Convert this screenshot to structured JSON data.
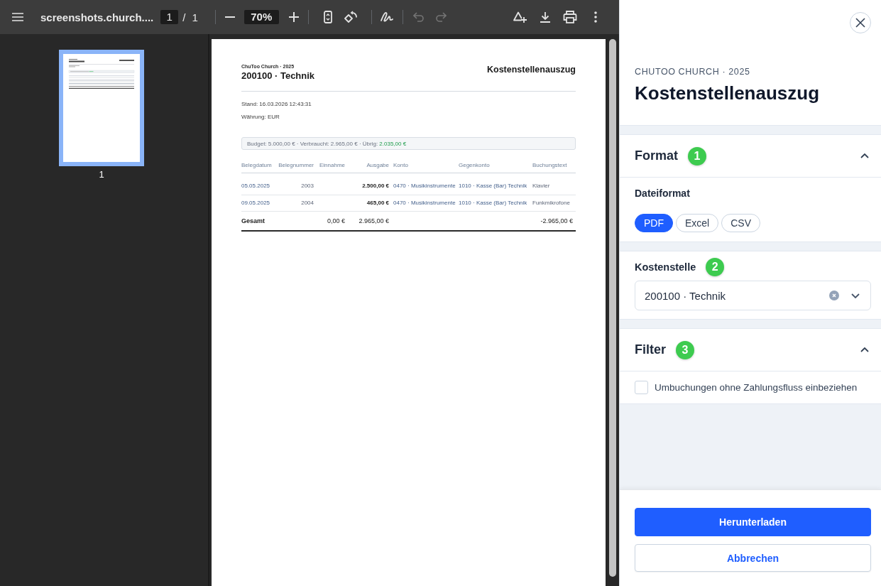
{
  "viewer": {
    "toolbar": {
      "title": "screenshots.church....",
      "page_number": "1",
      "page_separator": "/",
      "page_count": "1",
      "zoom": "70%",
      "undo_disabled": true,
      "redo_disabled": true
    },
    "thumbnails": [
      {
        "label": "1",
        "selected": true
      }
    ],
    "document": {
      "organization": "ChuToo Church · 2025",
      "cost_center": "200100 · Technik",
      "title": "Kostenstellenauszug",
      "meta": [
        "Stand: 16.03.2026 12:43:31",
        "Währung: EUR"
      ],
      "budget": {
        "text": "Budget: 5.000,00 € · Verbraucht: 2.965,00 € · Übrig:",
        "remaining": "2.035,00 €"
      },
      "table": {
        "columns": [
          "Belegdatum",
          "Belegnummer",
          "Einnahme",
          "Ausgabe",
          "Konto",
          "Gegenkonto",
          "Buchungstext"
        ],
        "rows": [
          {
            "date": "05.05.2025",
            "number": "2003",
            "expense": "2.500,00 €",
            "account": "0470 · Musikinstrumente",
            "contra_account": "1010 · Kasse (Bar) Technik",
            "text": "Klavier"
          },
          {
            "date": "09.05.2025",
            "number": "2004",
            "expense": "465,00 €",
            "account": "0470 · Musikinstrumente",
            "contra_account": "1010 · Kasse (Bar) Technik",
            "text": "Funkmikrofone"
          }
        ],
        "total": {
          "label": "Gesamt",
          "income": "0,00 €",
          "expense": "2.965,00 €",
          "balance": "-2.965,00 €"
        }
      }
    }
  },
  "panel": {
    "eyebrow": "CHUTOO CHURCH · 2025",
    "title": "Kostenstellenauszug",
    "sections": [
      {
        "kind": "choice",
        "title": "Format",
        "badge": "1",
        "expanded": true,
        "field_label": "Dateiformat",
        "options": [
          {
            "label": "PDF",
            "selected": true
          },
          {
            "label": "Excel",
            "selected": false
          },
          {
            "label": "CSV",
            "selected": false
          }
        ]
      },
      {
        "kind": "select",
        "label": "Kostenstelle",
        "badge": "2",
        "value": "200100 · Technik"
      },
      {
        "kind": "checklist",
        "title": "Filter",
        "badge": "3",
        "expanded": true,
        "options": [
          {
            "label": "Umbuchungen ohne Zahlungsfluss einbeziehen",
            "checked": false
          }
        ]
      }
    ],
    "buttons": [
      {
        "label": "Herunterladen",
        "kind": "primary"
      },
      {
        "label": "Abbrechen",
        "kind": "secondary"
      }
    ]
  }
}
